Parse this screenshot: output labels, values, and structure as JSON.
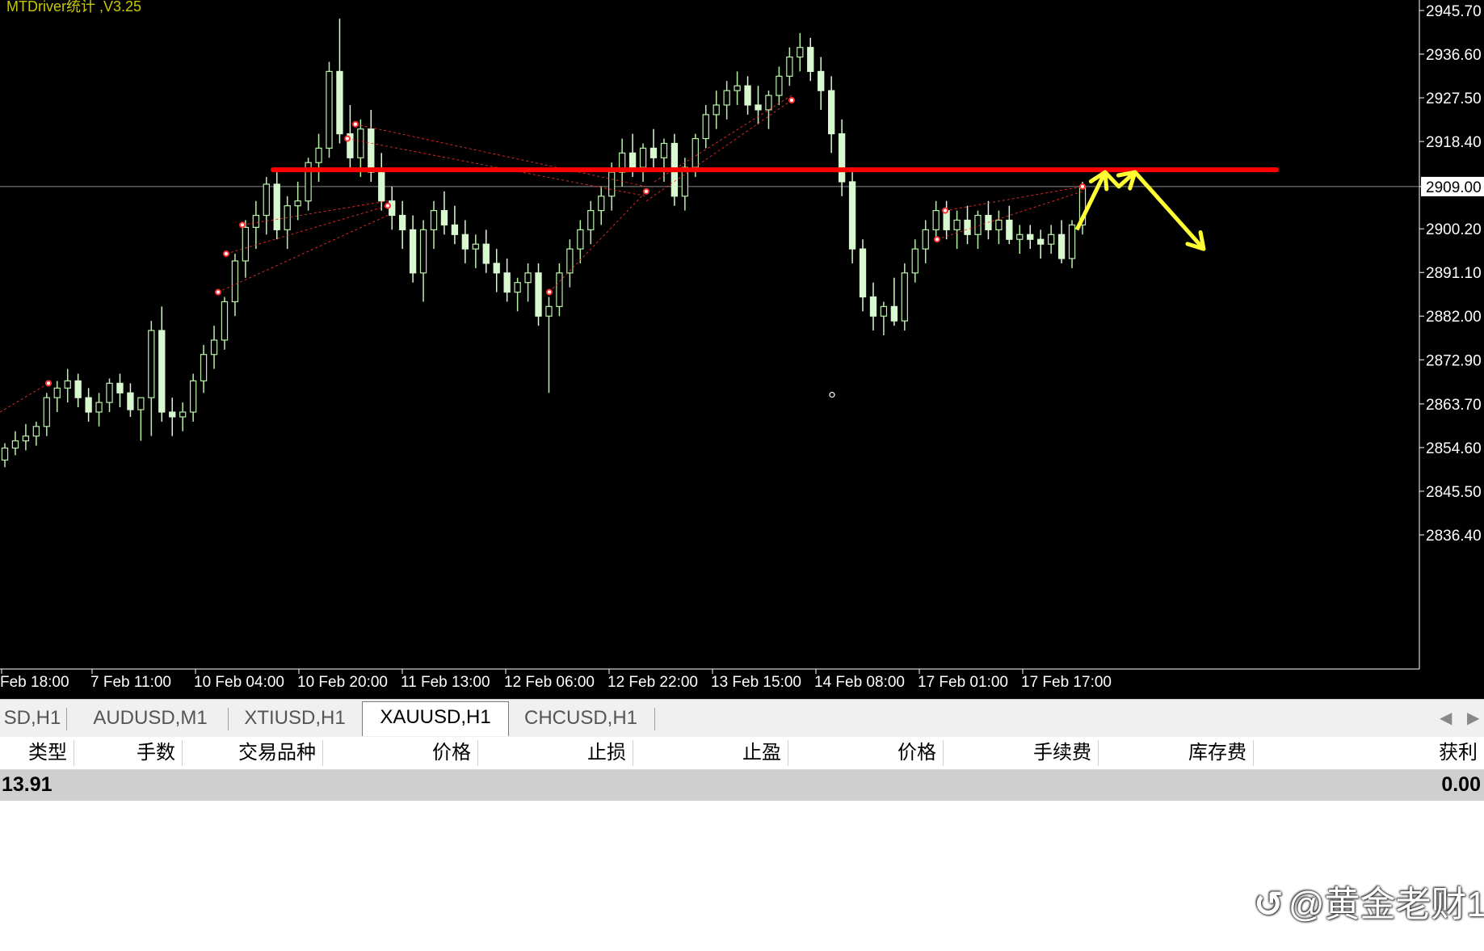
{
  "chart": {
    "title": "MTDriver统计 ,V3.25",
    "symbol": "XAUUSD",
    "timeframe": "H1",
    "current_price_label": "2909.00",
    "colors": {
      "background": "#000000",
      "bull_candle": "#b8f0a8",
      "bear_candle": "#d8f8d0",
      "axis_text": "#ffffff",
      "resistance_line": "#ff0000",
      "forecast_arrow": "#ffff33",
      "trade_markers": "#ff3030"
    },
    "price_ticks": [
      "2945.70",
      "2936.60",
      "2927.50",
      "2918.40",
      "2909.00",
      "2900.20",
      "2891.10",
      "2882.00",
      "2872.90",
      "2863.70",
      "2854.60",
      "2845.50",
      "2836.40"
    ],
    "time_ticks": [
      "Feb 18:00",
      "7 Feb 11:00",
      "10 Feb 04:00",
      "10 Feb 20:00",
      "11 Feb 13:00",
      "12 Feb 06:00",
      "12 Feb 22:00",
      "13 Feb 15:00",
      "14 Feb 08:00",
      "17 Feb 01:00",
      "17 Feb 17:00"
    ]
  },
  "chart_data": {
    "type": "candlestick",
    "title": "MTDriver统计 ,V3.25",
    "ylim": [
      2831.0,
      2948.0
    ],
    "y_ticks": [
      2945.7,
      2936.6,
      2927.5,
      2918.4,
      2909.0,
      2900.2,
      2891.1,
      2882.0,
      2872.9,
      2863.7,
      2854.6,
      2845.5,
      2836.4
    ],
    "x_tick_labels": [
      "Feb 18:00",
      "7 Feb 11:00",
      "10 Feb 04:00",
      "10 Feb 20:00",
      "11 Feb 13:00",
      "12 Feb 06:00",
      "12 Feb 22:00",
      "13 Feb 15:00",
      "14 Feb 08:00",
      "17 Feb 01:00",
      "17 Feb 17:00"
    ],
    "current_price": 2909.0,
    "resistance_level": 2912.5,
    "series": [
      {
        "values": [
          [
            2852.0,
            2855.5,
            2850.5,
            2854.5
          ],
          [
            2854.5,
            2858.0,
            2853.0,
            2856.0
          ],
          [
            2856.0,
            2859.5,
            2854.0,
            2857.0
          ],
          [
            2857.0,
            2860.0,
            2855.0,
            2859.0
          ],
          [
            2859.0,
            2866.0,
            2857.0,
            2865.0
          ],
          [
            2865.0,
            2868.5,
            2862.0,
            2867.0
          ],
          [
            2867.0,
            2871.0,
            2864.0,
            2868.5
          ],
          [
            2868.5,
            2870.0,
            2863.0,
            2865.0
          ],
          [
            2865.0,
            2867.0,
            2860.0,
            2862.0
          ],
          [
            2862.0,
            2866.0,
            2859.0,
            2864.0
          ],
          [
            2864.0,
            2869.0,
            2862.0,
            2868.0
          ],
          [
            2868.0,
            2870.0,
            2863.0,
            2866.0
          ],
          [
            2866.0,
            2868.0,
            2861.0,
            2862.5
          ],
          [
            2862.5,
            2865.0,
            2856.0,
            2865.0
          ],
          [
            2865.0,
            2881.0,
            2857.0,
            2879.0
          ],
          [
            2879.0,
            2884.0,
            2860.0,
            2862.0
          ],
          [
            2862.0,
            2865.0,
            2857.0,
            2861.0
          ],
          [
            2861.0,
            2864.0,
            2858.0,
            2862.0
          ],
          [
            2862.0,
            2870.0,
            2860.0,
            2868.5
          ],
          [
            2868.5,
            2876.0,
            2866.0,
            2874.0
          ],
          [
            2874.0,
            2880.0,
            2871.0,
            2877.0
          ],
          [
            2877.0,
            2886.0,
            2875.0,
            2885.0
          ],
          [
            2885.0,
            2895.0,
            2882.0,
            2893.5
          ],
          [
            2893.5,
            2902.0,
            2890.0,
            2900.5
          ],
          [
            2900.5,
            2906.0,
            2896.0,
            2903.0
          ],
          [
            2903.0,
            2911.0,
            2899.0,
            2909.5
          ],
          [
            2909.5,
            2912.0,
            2898.0,
            2900.0
          ],
          [
            2900.0,
            2907.0,
            2896.0,
            2905.0
          ],
          [
            2905.0,
            2910.0,
            2902.0,
            2906.0
          ],
          [
            2906.0,
            2915.0,
            2904.0,
            2914.0
          ],
          [
            2914.0,
            2920.0,
            2910.0,
            2917.0
          ],
          [
            2917.0,
            2935.0,
            2915.0,
            2933.0
          ],
          [
            2933.0,
            2944.0,
            2918.0,
            2920.0
          ],
          [
            2920.0,
            2926.0,
            2912.0,
            2915.0
          ],
          [
            2915.0,
            2923.0,
            2911.0,
            2921.0
          ],
          [
            2921.0,
            2925.0,
            2910.0,
            2912.0
          ],
          [
            2912.0,
            2916.0,
            2904.0,
            2906.0
          ],
          [
            2906.0,
            2909.0,
            2900.0,
            2903.0
          ],
          [
            2903.0,
            2906.0,
            2896.0,
            2900.0
          ],
          [
            2900.0,
            2903.0,
            2889.0,
            2891.0
          ],
          [
            2891.0,
            2902.0,
            2885.0,
            2900.0
          ],
          [
            2900.0,
            2906.0,
            2896.0,
            2904.0
          ],
          [
            2904.0,
            2908.0,
            2899.0,
            2901.0
          ],
          [
            2901.0,
            2905.0,
            2897.0,
            2899.0
          ],
          [
            2899.0,
            2902.0,
            2893.0,
            2896.0
          ],
          [
            2896.0,
            2899.0,
            2892.0,
            2897.0
          ],
          [
            2897.0,
            2900.0,
            2891.0,
            2893.0
          ],
          [
            2893.0,
            2896.0,
            2887.0,
            2891.0
          ],
          [
            2891.0,
            2894.0,
            2885.0,
            2887.0
          ],
          [
            2887.0,
            2890.0,
            2883.0,
            2889.0
          ],
          [
            2889.0,
            2893.0,
            2885.0,
            2891.0
          ],
          [
            2891.0,
            2893.0,
            2880.0,
            2882.0
          ],
          [
            2882.0,
            2886.0,
            2866.0,
            2884.0
          ],
          [
            2884.0,
            2893.0,
            2882.0,
            2891.0
          ],
          [
            2891.0,
            2898.0,
            2888.0,
            2896.0
          ],
          [
            2896.0,
            2902.0,
            2893.0,
            2900.0
          ],
          [
            2900.0,
            2906.0,
            2897.0,
            2904.0
          ],
          [
            2904.0,
            2909.0,
            2901.0,
            2907.0
          ],
          [
            2907.0,
            2914.0,
            2904.0,
            2912.0
          ],
          [
            2912.0,
            2919.0,
            2909.0,
            2916.0
          ],
          [
            2916.0,
            2920.0,
            2911.0,
            2913.0
          ],
          [
            2913.0,
            2918.0,
            2910.0,
            2917.0
          ],
          [
            2917.0,
            2921.0,
            2913.0,
            2915.0
          ],
          [
            2915.0,
            2919.0,
            2910.0,
            2918.0
          ],
          [
            2918.0,
            2920.0,
            2905.0,
            2907.0
          ],
          [
            2907.0,
            2915.0,
            2904.0,
            2913.0
          ],
          [
            2913.0,
            2920.0,
            2911.0,
            2919.0
          ],
          [
            2919.0,
            2926.0,
            2917.0,
            2924.0
          ],
          [
            2924.0,
            2929.0,
            2921.0,
            2926.0
          ],
          [
            2926.0,
            2931.0,
            2923.0,
            2929.0
          ],
          [
            2929.0,
            2933.0,
            2926.0,
            2930.0
          ],
          [
            2930.0,
            2932.0,
            2924.0,
            2926.0
          ],
          [
            2926.0,
            2930.0,
            2922.0,
            2925.0
          ],
          [
            2925.0,
            2929.0,
            2921.0,
            2928.0
          ],
          [
            2928.0,
            2934.0,
            2926.0,
            2932.0
          ],
          [
            2932.0,
            2938.0,
            2930.0,
            2936.0
          ],
          [
            2936.0,
            2941.0,
            2933.0,
            2938.0
          ],
          [
            2938.0,
            2940.0,
            2931.0,
            2933.0
          ],
          [
            2933.0,
            2936.0,
            2925.0,
            2929.0
          ],
          [
            2929.0,
            2932.0,
            2916.0,
            2920.0
          ],
          [
            2920.0,
            2923.0,
            2907.0,
            2910.0
          ],
          [
            2910.0,
            2913.0,
            2893.0,
            2896.0
          ],
          [
            2896.0,
            2898.0,
            2883.0,
            2886.0
          ],
          [
            2886.0,
            2889.0,
            2879.0,
            2882.0
          ],
          [
            2882.0,
            2885.0,
            2878.0,
            2884.0
          ],
          [
            2884.0,
            2890.0,
            2880.0,
            2881.0
          ],
          [
            2881.0,
            2893.0,
            2879.0,
            2891.0
          ],
          [
            2891.0,
            2898.0,
            2889.0,
            2896.0
          ],
          [
            2896.0,
            2902.0,
            2893.0,
            2900.0
          ],
          [
            2900.0,
            2906.0,
            2898.0,
            2904.0
          ],
          [
            2904.0,
            2906.0,
            2898.0,
            2900.0
          ],
          [
            2900.0,
            2904.0,
            2896.0,
            2902.0
          ],
          [
            2902.0,
            2905.0,
            2897.0,
            2899.0
          ],
          [
            2899.0,
            2904.0,
            2896.0,
            2903.0
          ],
          [
            2903.0,
            2906.0,
            2898.0,
            2900.0
          ],
          [
            2900.0,
            2904.0,
            2897.0,
            2902.0
          ],
          [
            2902.0,
            2905.0,
            2897.0,
            2898.0
          ],
          [
            2898.0,
            2901.0,
            2895.0,
            2899.0
          ],
          [
            2899.0,
            2901.0,
            2896.0,
            2898.0
          ],
          [
            2898.0,
            2900.0,
            2894.0,
            2897.0
          ],
          [
            2897.0,
            2901.0,
            2895.0,
            2899.0
          ],
          [
            2899.0,
            2902.0,
            2893.0,
            2894.0
          ],
          [
            2894.0,
            2902.0,
            2892.0,
            2901.0
          ],
          [
            2901.0,
            2910.0,
            2899.0,
            2909.0
          ]
        ]
      }
    ],
    "annotations": [
      {
        "type": "horizontal_line",
        "price": 2912.5,
        "color": "#ff0000"
      },
      {
        "type": "forecast_arrow",
        "color": "#ffff33"
      },
      {
        "type": "pivot_marker",
        "price": 2865.6
      }
    ]
  },
  "tabs": {
    "items": [
      "SD,H1",
      "AUDUSD,M1",
      "XTIUSD,H1",
      "XAUUSD,H1",
      "CHCUSD,H1"
    ],
    "active": "XAUUSD,H1",
    "scroll_left": "◀",
    "scroll_right": "▶"
  },
  "table": {
    "columns": [
      "类型",
      "手数",
      "交易品种",
      "价格",
      "止损",
      "止盈",
      "价格",
      "手续费",
      "库存费",
      "获利"
    ],
    "summary_left": "13.91",
    "summary_profit": "0.00"
  },
  "watermark": {
    "icon": "↺",
    "text": "@黄金老财1"
  }
}
